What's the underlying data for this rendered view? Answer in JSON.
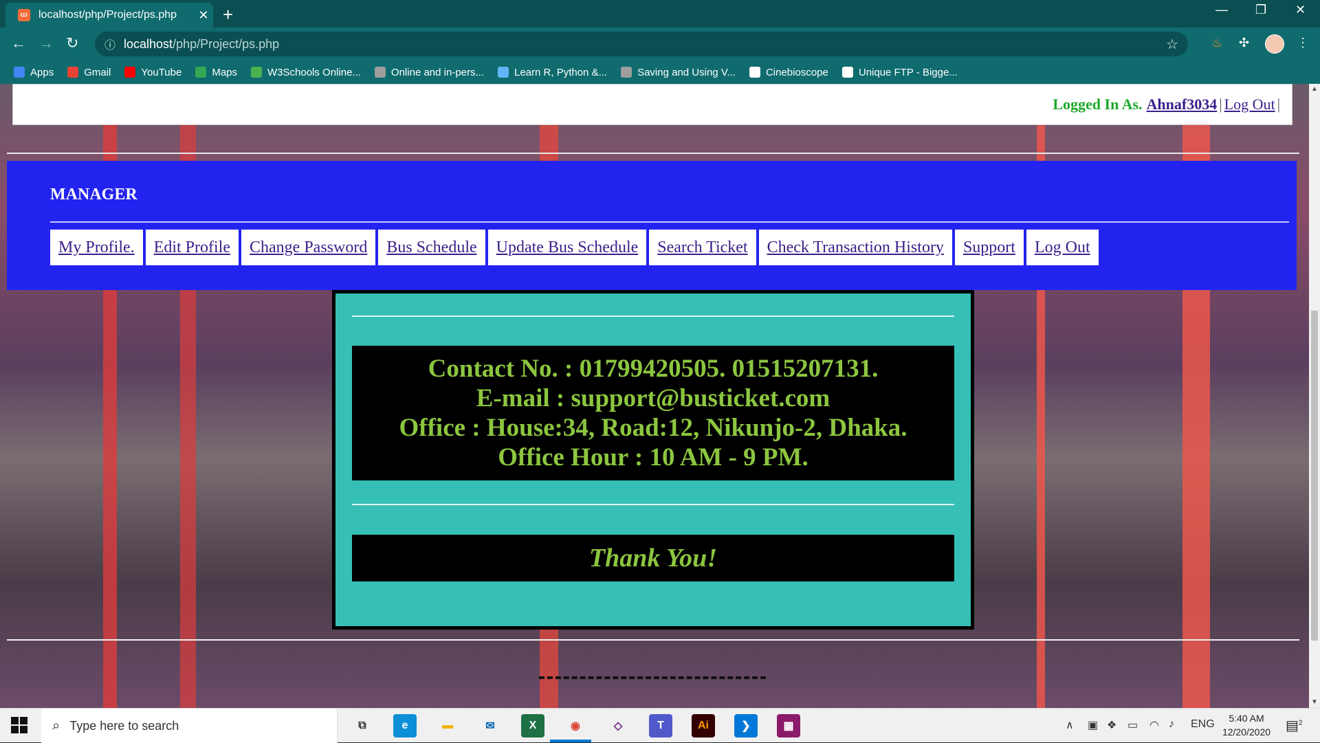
{
  "browser": {
    "tab_title": "localhost/php/Project/ps.php",
    "tab_favicon": "xampp-icon",
    "url_host": "localhost",
    "url_path": "/php/Project/ps.php",
    "bookmarks": [
      {
        "label": "Apps",
        "icon": "apps-grid-icon",
        "color": "#4285f4"
      },
      {
        "label": "Gmail",
        "icon": "gmail-icon",
        "color": "#ea4335"
      },
      {
        "label": "YouTube",
        "icon": "youtube-icon",
        "color": "#ff0000"
      },
      {
        "label": "Maps",
        "icon": "maps-pin-icon",
        "color": "#34a853"
      },
      {
        "label": "W3Schools Online...",
        "icon": "w3schools-icon",
        "color": "#4caf50"
      },
      {
        "label": "Online and in-pers...",
        "icon": "link-icon",
        "color": "#9e9e9e"
      },
      {
        "label": "Learn R, Python &...",
        "icon": "shield-icon",
        "color": "#64b5f6"
      },
      {
        "label": "Saving and Using V...",
        "icon": "page-icon",
        "color": "#9e9e9e"
      },
      {
        "label": "Cinebioscope",
        "icon": "globe-icon",
        "color": "#ffffff"
      },
      {
        "label": "Unique FTP - Bigge...",
        "icon": "globe-icon",
        "color": "#ffffff"
      }
    ]
  },
  "page": {
    "login_label": "Logged In As.",
    "username": "Ahnaf3034",
    "logout_top": "Log Out",
    "separator": "|",
    "manager_title": "MANAGER",
    "menu": [
      "My Profile.",
      "Edit Profile",
      "Change Password",
      "Bus Schedule",
      "Update Bus Schedule",
      "Search Ticket",
      "Check Transaction History",
      "Support",
      "Log Out"
    ],
    "contact_lines": [
      "Contact No. : 01799420505. 01515207131.",
      "E-mail : support@busticket.com",
      "Office : House:34, Road:12, Nikunjo-2, Dhaka.",
      "Office Hour : 10 AM - 9 PM."
    ],
    "thanks": "Thank You!",
    "colors": {
      "panel_blue": "#2323f0",
      "support_teal": "#36bfb6",
      "text_green": "#8cc63f",
      "login_green": "#1ea82a"
    }
  },
  "taskbar": {
    "search_placeholder": "Type here to search",
    "apps": [
      {
        "name": "task-view-icon",
        "label": "⧉",
        "color": "#333333",
        "bg": "transparent"
      },
      {
        "name": "edge-icon",
        "label": "e",
        "color": "#ffffff",
        "bg": "#0c8fd6"
      },
      {
        "name": "file-explorer-icon",
        "label": "▬",
        "color": "#f4b400",
        "bg": "transparent"
      },
      {
        "name": "mail-icon",
        "label": "✉",
        "color": "#0063b1",
        "bg": "transparent"
      },
      {
        "name": "excel-icon",
        "label": "X",
        "color": "#ffffff",
        "bg": "#1e7145"
      },
      {
        "name": "chrome-icon",
        "label": "◉",
        "color": "#db4437",
        "bg": "transparent"
      },
      {
        "name": "visual-studio-icon",
        "label": "◇",
        "color": "#68217a",
        "bg": "transparent"
      },
      {
        "name": "teams-icon",
        "label": "T",
        "color": "#ffffff",
        "bg": "#5059c9"
      },
      {
        "name": "illustrator-icon",
        "label": "Ai",
        "color": "#ff9a00",
        "bg": "#330000"
      },
      {
        "name": "vscode-icon",
        "label": "❯",
        "color": "#ffffff",
        "bg": "#0078d7"
      },
      {
        "name": "winrar-icon",
        "label": "▦",
        "color": "#ffffff",
        "bg": "#8b1a6a"
      }
    ],
    "language": "ENG",
    "time": "5:40 AM",
    "date": "12/20/2020",
    "notification_count": "2"
  }
}
